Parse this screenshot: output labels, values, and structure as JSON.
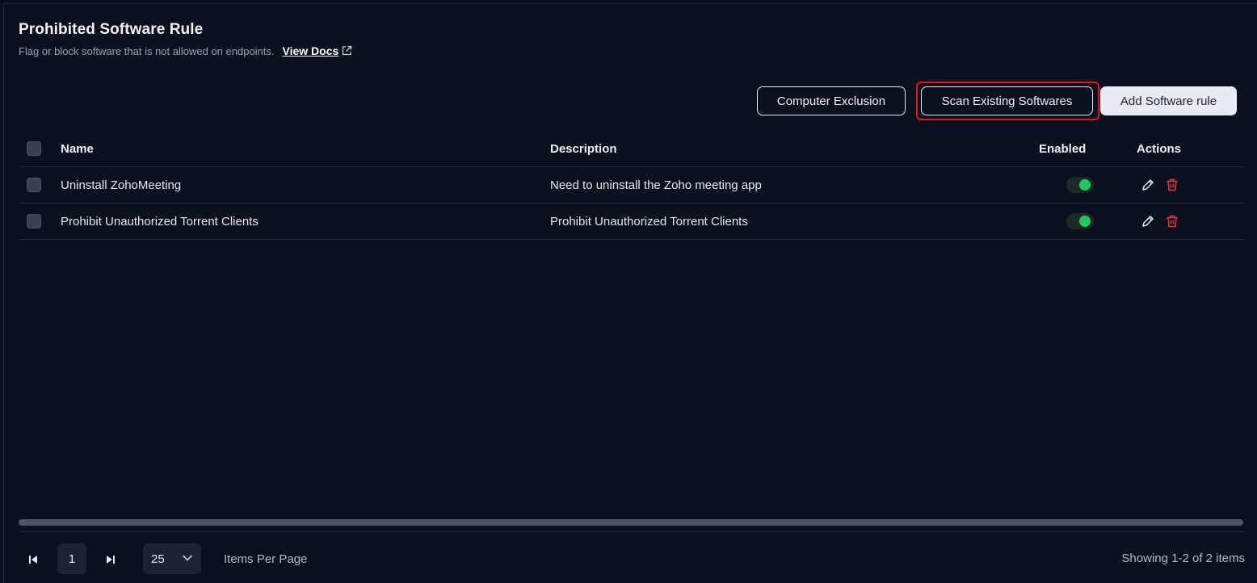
{
  "header": {
    "title": "Prohibited Software Rule",
    "subtitle": "Flag or block software that is not allowed on endpoints.",
    "docs_link": "View Docs"
  },
  "toolbar": {
    "computer_exclusion": "Computer Exclusion",
    "scan_existing": "Scan Existing Softwares",
    "add_rule": "Add Software rule"
  },
  "table": {
    "columns": {
      "name": "Name",
      "description": "Description",
      "enabled": "Enabled",
      "actions": "Actions"
    },
    "rows": [
      {
        "name": "Uninstall ZohoMeeting",
        "description": "Need to uninstall the Zoho meeting app",
        "enabled": true
      },
      {
        "name": "Prohibit Unauthorized Torrent Clients",
        "description": "Prohibit Unauthorized Torrent Clients",
        "enabled": true
      }
    ]
  },
  "pagination": {
    "current_page": "1",
    "per_page": "25",
    "per_page_label": "Items Per Page",
    "showing": "Showing 1-2 of 2 items"
  },
  "colors": {
    "background": "#0a101d",
    "toggle_on": "#22c55e",
    "delete_icon": "#e0393e",
    "highlight": "#e3121b"
  }
}
